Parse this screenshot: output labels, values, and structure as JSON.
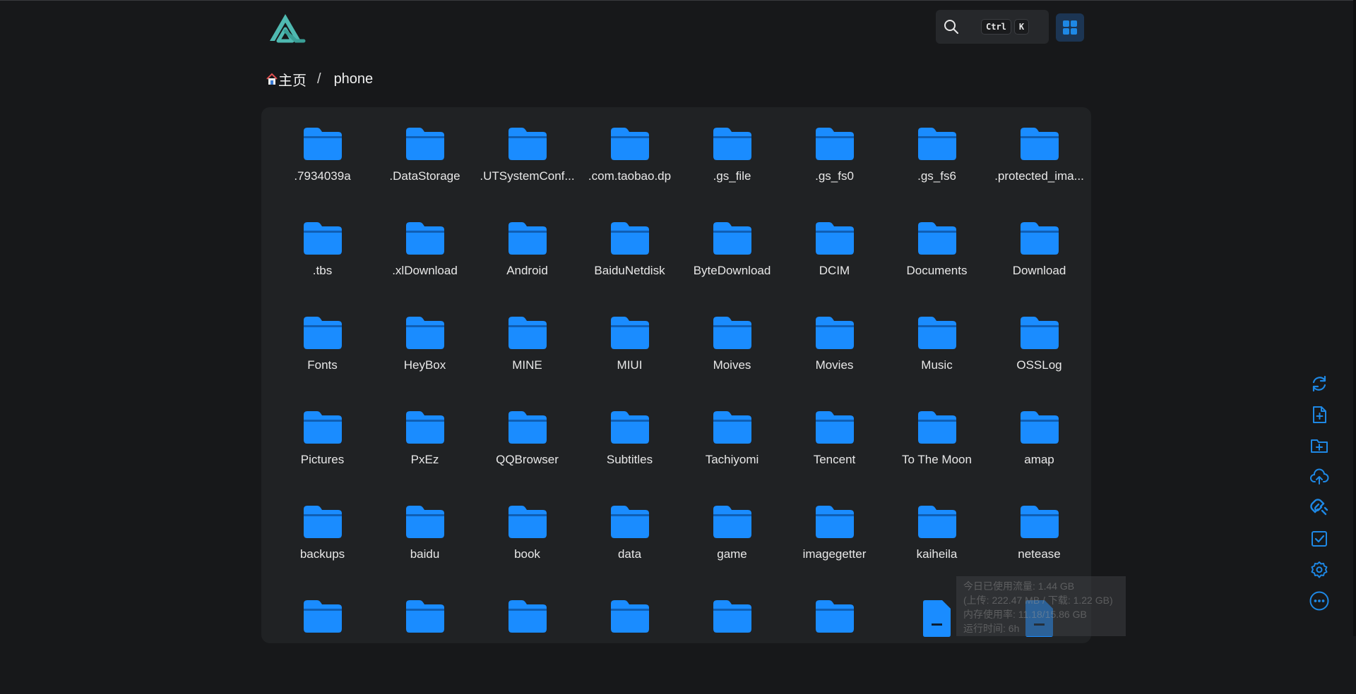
{
  "breadcrumb": {
    "home_label": "主页",
    "separator": "/",
    "current": "phone"
  },
  "search": {
    "shortcut_keys": [
      "Ctrl",
      "K"
    ]
  },
  "colors": {
    "accent": "#1e88e5",
    "folder": "#1a8cff",
    "logo": "#4fb9b1"
  },
  "items": [
    {
      "name": ".7934039a",
      "type": "folder"
    },
    {
      "name": ".DataStorage",
      "type": "folder"
    },
    {
      "name": ".UTSystemConf...",
      "type": "folder"
    },
    {
      "name": ".com.taobao.dp",
      "type": "folder"
    },
    {
      "name": ".gs_file",
      "type": "folder"
    },
    {
      "name": ".gs_fs0",
      "type": "folder"
    },
    {
      "name": ".gs_fs6",
      "type": "folder"
    },
    {
      "name": ".protected_ima...",
      "type": "folder"
    },
    {
      "name": ".tbs",
      "type": "folder"
    },
    {
      "name": ".xlDownload",
      "type": "folder"
    },
    {
      "name": "Android",
      "type": "folder"
    },
    {
      "name": "BaiduNetdisk",
      "type": "folder"
    },
    {
      "name": "ByteDownload",
      "type": "folder"
    },
    {
      "name": "DCIM",
      "type": "folder"
    },
    {
      "name": "Documents",
      "type": "folder"
    },
    {
      "name": "Download",
      "type": "folder"
    },
    {
      "name": "Fonts",
      "type": "folder"
    },
    {
      "name": "HeyBox",
      "type": "folder"
    },
    {
      "name": "MINE",
      "type": "folder"
    },
    {
      "name": "MIUI",
      "type": "folder"
    },
    {
      "name": "Moives",
      "type": "folder"
    },
    {
      "name": "Movies",
      "type": "folder"
    },
    {
      "name": "Music",
      "type": "folder"
    },
    {
      "name": "OSSLog",
      "type": "folder"
    },
    {
      "name": "Pictures",
      "type": "folder"
    },
    {
      "name": "PxEz",
      "type": "folder"
    },
    {
      "name": "QQBrowser",
      "type": "folder"
    },
    {
      "name": "Subtitles",
      "type": "folder"
    },
    {
      "name": "Tachiyomi",
      "type": "folder"
    },
    {
      "name": "Tencent",
      "type": "folder"
    },
    {
      "name": "To The Moon",
      "type": "folder"
    },
    {
      "name": "amap",
      "type": "folder"
    },
    {
      "name": "backups",
      "type": "folder"
    },
    {
      "name": "baidu",
      "type": "folder"
    },
    {
      "name": "book",
      "type": "folder"
    },
    {
      "name": "data",
      "type": "folder"
    },
    {
      "name": "game",
      "type": "folder"
    },
    {
      "name": "imagegetter",
      "type": "folder"
    },
    {
      "name": "kaiheila",
      "type": "folder"
    },
    {
      "name": "netease",
      "type": "folder"
    },
    {
      "name": "",
      "type": "folder"
    },
    {
      "name": "",
      "type": "folder"
    },
    {
      "name": "",
      "type": "folder"
    },
    {
      "name": "",
      "type": "folder"
    },
    {
      "name": "",
      "type": "folder"
    },
    {
      "name": "",
      "type": "folder"
    },
    {
      "name": "",
      "type": "file"
    },
    {
      "name": "",
      "type": "file"
    }
  ],
  "overlay_lines": [
    "今日已使用流量: 1.44 GB",
    "(上传: 222.47 MB / 下载: 1.22 GB)",
    "内存使用率: 11.18/15.86 GB",
    "运行时间: 6h"
  ],
  "side_tools": [
    "refresh-icon",
    "new-file-icon",
    "new-folder-icon",
    "upload-icon",
    "offline-download-icon",
    "select-icon",
    "settings-icon",
    "more-icon"
  ]
}
